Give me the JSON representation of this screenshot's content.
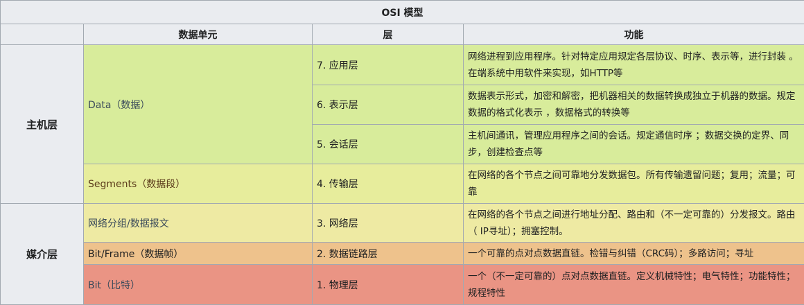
{
  "table": {
    "caption": "OSI 模型",
    "headers": {
      "unit": "数据单元",
      "layer": "层",
      "function": "功能"
    },
    "groups": {
      "host": "主机层",
      "media": "媒介层"
    },
    "rows": [
      {
        "unit": "Data（数据）",
        "layer": "7. 应用层",
        "function": "网络进程到应用程序。针对特定应用规定各层协议、时序、表示等，进行封装 。在端系统中用软件来实现，如HTTP等"
      },
      {
        "layer": "6. 表示层",
        "function": "数据表示形式，加密和解密，把机器相关的数据转换成独立于机器的数据。规定数据的格式化表示 ，数据格式的转换等"
      },
      {
        "layer": "5. 会话层",
        "function": "主机间通讯，管理应用程序之间的会话。规定通信时序 ；数据交换的定界、同步，创建检查点等"
      },
      {
        "unit": "Segments（数据段）",
        "layer": "4. 传输层",
        "function": "在网络的各个节点之间可靠地分发数据包。所有传输遗留问题；复用；流量；可靠"
      },
      {
        "unit": "网络分组/数据报文",
        "layer": "3. 网络层",
        "function": "在网络的各个节点之间进行地址分配、路由和（不一定可靠的）分发报文。路由（ IP寻址）；拥塞控制。"
      },
      {
        "unit": "Bit/Frame（数据帧）",
        "layer": "2. 数据链路层",
        "function": "一个可靠的点对点数据直链。检错与纠错（CRC码）；多路访问；寻址"
      },
      {
        "unit": "Bit（比特）",
        "layer": "1. 物理层",
        "function": "一个（不一定可靠的）点对点数据直链。定义机械特性；电气特性；功能特性；规程特性"
      }
    ]
  },
  "colors": {
    "header_bg": "#eaecf0",
    "border": "#a2a9b1",
    "green": "#d8ec9b",
    "yellowgreen": "#e7ed9c",
    "yellow": "#eeeaa3",
    "orange": "#eec28c",
    "red": "#ea9484"
  }
}
